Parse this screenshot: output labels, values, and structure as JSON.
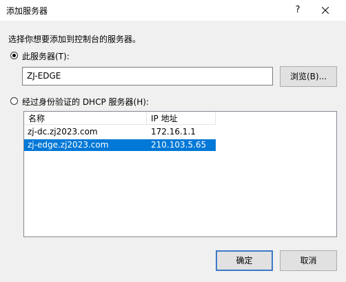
{
  "window": {
    "title": "添加服务器",
    "help_label": "?"
  },
  "instruction": "选择你想要添加到控制台的服务器。",
  "this_server": {
    "label": "此服务器(T):",
    "checked": true,
    "value": "ZJ-EDGE",
    "browse_label": "浏览(B)..."
  },
  "dhcp": {
    "label": "经过身份验证的 DHCP 服务器(H):",
    "checked": false,
    "columns": [
      "名称",
      "IP 地址"
    ],
    "rows": [
      {
        "name": "zj-dc.zj2023.com",
        "ip": "172.16.1.1",
        "selected": false
      },
      {
        "name": "zj-edge.zj2023.com",
        "ip": "210.103.5.65",
        "selected": true
      }
    ]
  },
  "buttons": {
    "ok": "确定",
    "cancel": "取消"
  },
  "colors": {
    "selection": "#0078d7",
    "dialog_bg": "#f0f0f0",
    "default_button_border": "#3c78c6"
  }
}
